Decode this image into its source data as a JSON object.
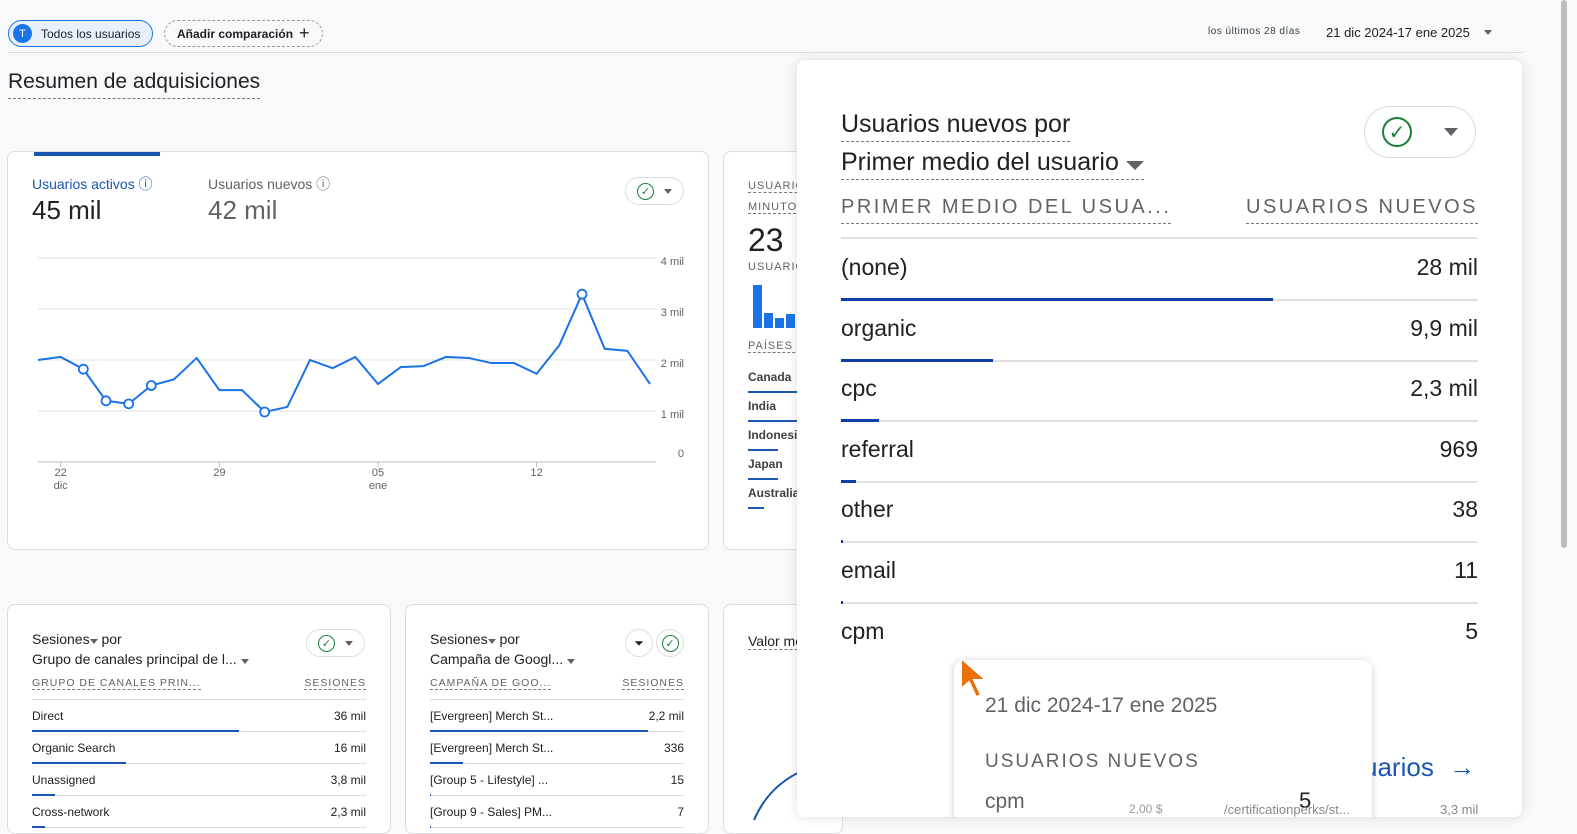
{
  "header": {
    "segment_initial": "T",
    "segment": "Todos los usuarios",
    "add_comparison": "Añadir comparación",
    "range_label": "los últimos 28 días",
    "date_range": "21 dic 2024-17 ene 2025"
  },
  "page_title": "Resumen de adquisiciones",
  "main_card": {
    "metric1_label": "Usuarios activos",
    "metric1_value": "45 mil",
    "metric2_label": "Usuarios nuevos",
    "metric2_value": "42 mil"
  },
  "chart_data": {
    "type": "line",
    "title": "Usuarios activos",
    "x_ticks": [
      {
        "label": "22",
        "sub": "dic",
        "index": 1
      },
      {
        "label": "29",
        "sub": "",
        "index": 8
      },
      {
        "label": "05",
        "sub": "ene",
        "index": 15
      },
      {
        "label": "12",
        "sub": "",
        "index": 22
      }
    ],
    "y_ticks": [
      "0",
      "1 mil",
      "2 mil",
      "3 mil",
      "4 mil"
    ],
    "ylim": [
      0,
      4000
    ],
    "values": [
      2000,
      2060,
      1820,
      1200,
      1140,
      1500,
      1620,
      2040,
      1410,
      1410,
      980,
      1080,
      2000,
      1840,
      2060,
      1530,
      1860,
      1880,
      2060,
      2040,
      1940,
      1940,
      1730,
      2290,
      3290,
      2220,
      2180,
      1530
    ],
    "markers": [
      2,
      3,
      4,
      5,
      10,
      24
    ]
  },
  "realtime_card": {
    "label1": "USUARIOS",
    "label2": "MINUTOS",
    "value": "23",
    "label3": "USUARIOS",
    "countries_label": "PAÍSES P",
    "countries": [
      "Canada",
      "India",
      "Indonesia",
      "Japan",
      "Australia"
    ]
  },
  "sessions_channel": {
    "title1": "Sesiones",
    "by": "por",
    "title2": "Grupo de canales principal de l...",
    "col1": "GRUPO DE CANALES PRIN...",
    "col2": "SESIONES",
    "rows": [
      {
        "name": "Direct",
        "value": "36 mil",
        "pct": 62
      },
      {
        "name": "Organic Search",
        "value": "16 mil",
        "pct": 28
      },
      {
        "name": "Unassigned",
        "value": "3,8 mil",
        "pct": 7
      },
      {
        "name": "Cross-network",
        "value": "2,3 mil",
        "pct": 4
      }
    ]
  },
  "sessions_campaign": {
    "title1": "Sesiones",
    "by": "por",
    "title2": "Campaña de Googl...",
    "col1": "CAMPAÑA DE GOO...",
    "col2": "SESIONES",
    "rows": [
      {
        "name": "[Evergreen] Merch St...",
        "value": "2,2 mil",
        "pct": 86
      },
      {
        "name": "[Evergreen] Merch St...",
        "value": "336",
        "pct": 13
      },
      {
        "name": "[Group 5 - Lifestyle] ...",
        "value": "15",
        "pct": 0.5
      },
      {
        "name": "[Group 9 - Sales] PM...",
        "value": "7",
        "pct": 0.3
      }
    ]
  },
  "value_card": {
    "title": "Valor me"
  },
  "magnifier": {
    "title1": "Usuarios nuevos por",
    "title2": "Primer medio del usuario",
    "col1": "PRIMER MEDIO DEL USUA...",
    "col2": "USUARIOS NUEVOS",
    "rows": [
      {
        "name": "(none)",
        "value": "28 mil",
        "pct": 68
      },
      {
        "name": "organic",
        "value": "9,9 mil",
        "pct": 24
      },
      {
        "name": "cpc",
        "value": "2,3 mil",
        "pct": 6
      },
      {
        "name": "referral",
        "value": "969",
        "pct": 2.4
      },
      {
        "name": "other",
        "value": "38",
        "pct": 0.3
      },
      {
        "name": "email",
        "value": "11",
        "pct": 0.2
      },
      {
        "name": "cpm",
        "value": "5",
        "pct": 0.1
      }
    ],
    "link": "uarios",
    "tooltip": {
      "date": "21 dic 2024-17 ene 2025",
      "metric": "USUARIOS NUEVOS",
      "row_name": "cpm",
      "row_value": "5"
    },
    "behind_texts": [
      "2,00 $",
      "/certificationperks/st...",
      "3,3 mil"
    ]
  }
}
